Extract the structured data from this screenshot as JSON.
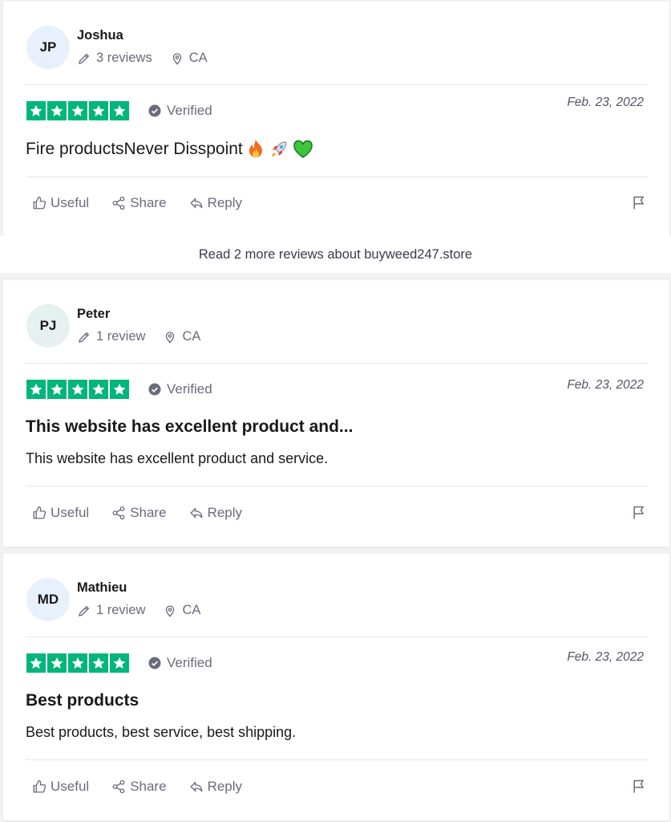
{
  "reviews": [
    {
      "initials": "JP",
      "avatar_color": "#e8f1fb",
      "name": "Joshua",
      "review_count": "3 reviews",
      "country": "CA",
      "rating": 5,
      "verified_label": "Verified",
      "date": "Feb. 23, 2022",
      "title": "Fire productsNever Disspoint",
      "emojis": [
        "fire-emoji",
        "rocket-emoji",
        "green-heart-emoji"
      ],
      "body": "",
      "actions": {
        "useful": "Useful",
        "share": "Share",
        "reply": "Reply"
      }
    },
    {
      "initials": "PJ",
      "avatar_color": "#e6f0ee",
      "name": "Peter",
      "review_count": "1 review",
      "country": "CA",
      "rating": 5,
      "verified_label": "Verified",
      "date": "Feb. 23, 2022",
      "title": "This website has excellent product and...",
      "body": "This website has excellent product and service.",
      "actions": {
        "useful": "Useful",
        "share": "Share",
        "reply": "Reply"
      }
    },
    {
      "initials": "MD",
      "avatar_color": "#e8f1fb",
      "name": "Mathieu",
      "review_count": "1 review",
      "country": "CA",
      "rating": 5,
      "verified_label": "Verified",
      "date": "Feb. 23, 2022",
      "title": "Best products",
      "body": "Best products, best service, best shipping.",
      "actions": {
        "useful": "Useful",
        "share": "Share",
        "reply": "Reply"
      }
    }
  ],
  "read_more": "Read 2 more reviews about buyweed247.store",
  "colors": {
    "star_green": "#00b67a",
    "muted_text": "#6b6b7b"
  }
}
